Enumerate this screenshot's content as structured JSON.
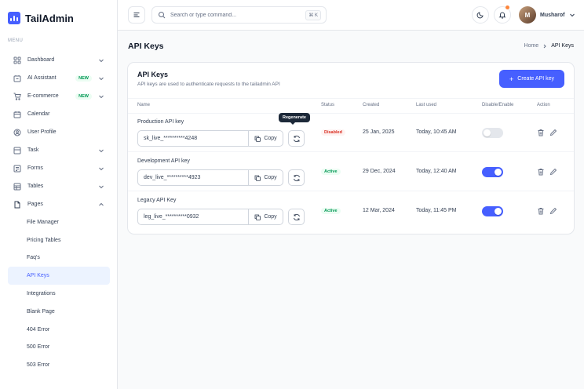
{
  "app": {
    "name": "TailAdmin"
  },
  "sidebar": {
    "menu_label": "MENU",
    "items": [
      {
        "label": "Dashboard",
        "icon": "grid-icon",
        "has_chevron": true
      },
      {
        "label": "AI Assistant",
        "icon": "ai-icon",
        "badge": "NEW",
        "has_chevron": true
      },
      {
        "label": "E-commerce",
        "icon": "cart-icon",
        "badge": "NEW",
        "has_chevron": true
      },
      {
        "label": "Calendar",
        "icon": "calendar-icon"
      },
      {
        "label": "User Profile",
        "icon": "user-icon"
      },
      {
        "label": "Task",
        "icon": "task-icon",
        "has_chevron": true
      },
      {
        "label": "Forms",
        "icon": "forms-icon",
        "has_chevron": true
      },
      {
        "label": "Tables",
        "icon": "tables-icon",
        "has_chevron": true
      },
      {
        "label": "Pages",
        "icon": "pages-icon",
        "has_chevron": true,
        "expanded": true
      }
    ],
    "subitems": [
      "File Manager",
      "Pricing Tables",
      "Faq's",
      "API Keys",
      "Integrations",
      "Blank Page",
      "404 Error",
      "500 Error",
      "503 Error"
    ],
    "active_subitem": "API Keys"
  },
  "header": {
    "search_placeholder": "Search or type command...",
    "shortcut": "⌘ K",
    "user_name": "Musharof",
    "avatar_initial": "M"
  },
  "page": {
    "title": "API Keys",
    "breadcrumb": {
      "home": "Home",
      "current": "API Keys"
    }
  },
  "card": {
    "title": "API Keys",
    "subtitle": "API keys are used to authenticate requests to the tailadmin API",
    "create_button": "Create API key",
    "columns": {
      "name": "Name",
      "status": "Status",
      "created": "Created",
      "last_used": "Last used",
      "toggle": "Disable/Enable",
      "action": "Action"
    },
    "rows": [
      {
        "name": "Production API key",
        "key": "sk_live_**********4248",
        "copy": "Copy",
        "status": "Disabled",
        "created": "25 Jan, 2025",
        "last_used": "Today, 10:45 AM",
        "enabled": false
      },
      {
        "name": "Development API key",
        "key": "dev_live_**********4923",
        "copy": "Copy",
        "status": "Active",
        "created": "29 Dec, 2024",
        "last_used": "Today, 12:40 AM",
        "enabled": true
      },
      {
        "name": "Legacy API Key",
        "key": "leg_live_**********0932",
        "copy": "Copy",
        "status": "Active",
        "created": "12 Mar, 2024",
        "last_used": "Today, 11:45 PM",
        "enabled": true
      }
    ],
    "tooltip": "Regenerate"
  },
  "colors": {
    "accent": "#465fff",
    "success": "#039855",
    "error": "#d92d20"
  }
}
